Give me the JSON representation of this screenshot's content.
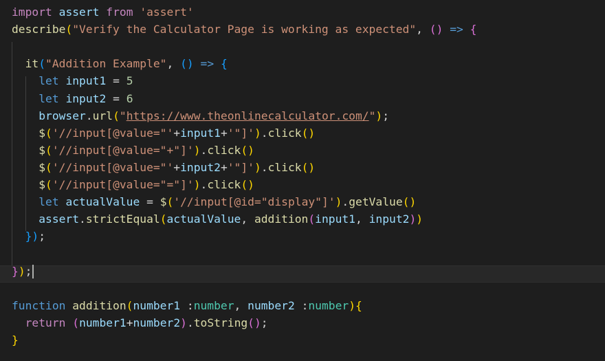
{
  "editor": {
    "lines": [
      [
        [
          "kw-ctrl",
          "import"
        ],
        [
          "op",
          " "
        ],
        [
          "var",
          "assert"
        ],
        [
          "op",
          " "
        ],
        [
          "kw-ctrl",
          "from"
        ],
        [
          "op",
          " "
        ],
        [
          "str",
          "'assert'"
        ]
      ],
      [
        [
          "fn",
          "describe"
        ],
        [
          "b1",
          "("
        ],
        [
          "str",
          "\"Verify the Calculator Page is working as expected\""
        ],
        [
          "op",
          ", "
        ],
        [
          "b2",
          "()"
        ],
        [
          "op",
          " "
        ],
        [
          "kw",
          "=>"
        ],
        [
          "op",
          " "
        ],
        [
          "b2",
          "{"
        ]
      ],
      [],
      [
        [
          "op",
          "  "
        ],
        [
          "fn",
          "it"
        ],
        [
          "b3",
          "("
        ],
        [
          "str",
          "\"Addition Example\""
        ],
        [
          "op",
          ", "
        ],
        [
          "b3",
          "()"
        ],
        [
          "op",
          " "
        ],
        [
          "kw",
          "=>"
        ],
        [
          "op",
          " "
        ],
        [
          "b3",
          "{"
        ]
      ],
      [
        [
          "op",
          "    "
        ],
        [
          "kw",
          "let"
        ],
        [
          "op",
          " "
        ],
        [
          "var",
          "input1"
        ],
        [
          "op",
          " = "
        ],
        [
          "num",
          "5"
        ]
      ],
      [
        [
          "op",
          "    "
        ],
        [
          "kw",
          "let"
        ],
        [
          "op",
          " "
        ],
        [
          "var",
          "input2"
        ],
        [
          "op",
          " = "
        ],
        [
          "num",
          "6"
        ]
      ],
      [
        [
          "op",
          "    "
        ],
        [
          "var",
          "browser"
        ],
        [
          "op",
          "."
        ],
        [
          "fn",
          "url"
        ],
        [
          "b1",
          "("
        ],
        [
          "str",
          "\""
        ],
        [
          "str link",
          "https://www.theonlinecalculator.com/"
        ],
        [
          "str",
          "\""
        ],
        [
          "b1",
          ")"
        ],
        [
          "op",
          ";"
        ]
      ],
      [
        [
          "op",
          "    "
        ],
        [
          "fn",
          "$"
        ],
        [
          "b1",
          "("
        ],
        [
          "str",
          "'//input[@value=\"'"
        ],
        [
          "op",
          "+"
        ],
        [
          "var",
          "input1"
        ],
        [
          "op",
          "+"
        ],
        [
          "str",
          "'\"]'"
        ],
        [
          "b1",
          ")"
        ],
        [
          "op",
          "."
        ],
        [
          "fn",
          "click"
        ],
        [
          "b1",
          "()"
        ]
      ],
      [
        [
          "op",
          "    "
        ],
        [
          "fn",
          "$"
        ],
        [
          "b1",
          "("
        ],
        [
          "str",
          "'//input[@value=\"+\"]'"
        ],
        [
          "b1",
          ")"
        ],
        [
          "op",
          "."
        ],
        [
          "fn",
          "click"
        ],
        [
          "b1",
          "()"
        ]
      ],
      [
        [
          "op",
          "    "
        ],
        [
          "fn",
          "$"
        ],
        [
          "b1",
          "("
        ],
        [
          "str",
          "'//input[@value=\"'"
        ],
        [
          "op",
          "+"
        ],
        [
          "var",
          "input2"
        ],
        [
          "op",
          "+"
        ],
        [
          "str",
          "'\"]'"
        ],
        [
          "b1",
          ")"
        ],
        [
          "op",
          "."
        ],
        [
          "fn",
          "click"
        ],
        [
          "b1",
          "()"
        ]
      ],
      [
        [
          "op",
          "    "
        ],
        [
          "fn",
          "$"
        ],
        [
          "b1",
          "("
        ],
        [
          "str",
          "'//input[@value=\"=\"]'"
        ],
        [
          "b1",
          ")"
        ],
        [
          "op",
          "."
        ],
        [
          "fn",
          "click"
        ],
        [
          "b1",
          "()"
        ]
      ],
      [
        [
          "op",
          "    "
        ],
        [
          "kw",
          "let"
        ],
        [
          "op",
          " "
        ],
        [
          "var",
          "actualValue"
        ],
        [
          "op",
          " = "
        ],
        [
          "fn",
          "$"
        ],
        [
          "b1",
          "("
        ],
        [
          "str",
          "'//input[@id=\"display\"]'"
        ],
        [
          "b1",
          ")"
        ],
        [
          "op",
          "."
        ],
        [
          "fn",
          "getValue"
        ],
        [
          "b1",
          "()"
        ]
      ],
      [
        [
          "op",
          "    "
        ],
        [
          "var",
          "assert"
        ],
        [
          "op",
          "."
        ],
        [
          "fn",
          "strictEqual"
        ],
        [
          "b1",
          "("
        ],
        [
          "var",
          "actualValue"
        ],
        [
          "op",
          ", "
        ],
        [
          "fn",
          "addition"
        ],
        [
          "b2",
          "("
        ],
        [
          "var",
          "input1"
        ],
        [
          "op",
          ", "
        ],
        [
          "var",
          "input2"
        ],
        [
          "b2",
          ")"
        ],
        [
          "b1",
          ")"
        ]
      ],
      [
        [
          "op",
          "  "
        ],
        [
          "b3",
          "}"
        ],
        [
          "b3",
          ")"
        ],
        [
          "op",
          ";"
        ]
      ],
      [],
      [
        [
          "b2",
          "}"
        ],
        [
          "b1",
          ")"
        ],
        [
          "op",
          ";"
        ]
      ],
      [],
      [
        [
          "kw",
          "function"
        ],
        [
          "op",
          " "
        ],
        [
          "fn",
          "addition"
        ],
        [
          "b1",
          "("
        ],
        [
          "var",
          "number1"
        ],
        [
          "op",
          " :"
        ],
        [
          "type",
          "number"
        ],
        [
          "op",
          ", "
        ],
        [
          "var",
          "number2"
        ],
        [
          "op",
          " :"
        ],
        [
          "type",
          "number"
        ],
        [
          "b1",
          ")"
        ],
        [
          "b1",
          "{"
        ]
      ],
      [
        [
          "op",
          "  "
        ],
        [
          "kw-ctrl",
          "return"
        ],
        [
          "op",
          " "
        ],
        [
          "b2",
          "("
        ],
        [
          "var",
          "number1"
        ],
        [
          "op",
          "+"
        ],
        [
          "var",
          "number2"
        ],
        [
          "b2",
          ")"
        ],
        [
          "op",
          "."
        ],
        [
          "fn",
          "toString"
        ],
        [
          "b2",
          "()"
        ],
        [
          "op",
          ";"
        ]
      ],
      [
        [
          "b1",
          "}"
        ]
      ]
    ]
  }
}
